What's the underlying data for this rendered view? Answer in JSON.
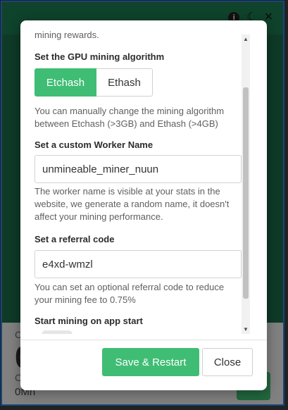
{
  "window": {
    "icons": [
      "info-icon",
      "moon-icon",
      "close-icon"
    ]
  },
  "background": {
    "stat_top_label": "C",
    "stat_big_value": "0",
    "stat_bottom_label": "C",
    "hashrate": "0Mh"
  },
  "modal": {
    "cut_off_text": "mining rewards.",
    "algorithm": {
      "label": "Set the GPU mining algorithm",
      "options": [
        "Etchash",
        "Ethash"
      ],
      "selected": "Etchash",
      "help": "You can manually change the mining algorithm between Etchash (>3GB) and Ethash (>4GB)"
    },
    "worker": {
      "label": "Set a custom Worker Name",
      "value": "unmineable_miner_nuun",
      "help": "The worker name is visible at your stats in the website, we generate a random name, it doesn't affect your mining performance."
    },
    "referral": {
      "label": "Set a referral code",
      "value": "e4xd-wmzl",
      "help": "You can set an optional referral code to reduce your mining fee to 0.75%"
    },
    "start_on_app_start": {
      "label": "Start mining on app start"
    },
    "buttons": {
      "save": "Save & Restart",
      "close": "Close"
    }
  },
  "colors": {
    "accent_green": "#3fbd74",
    "window_border": "#2f7fe0"
  }
}
